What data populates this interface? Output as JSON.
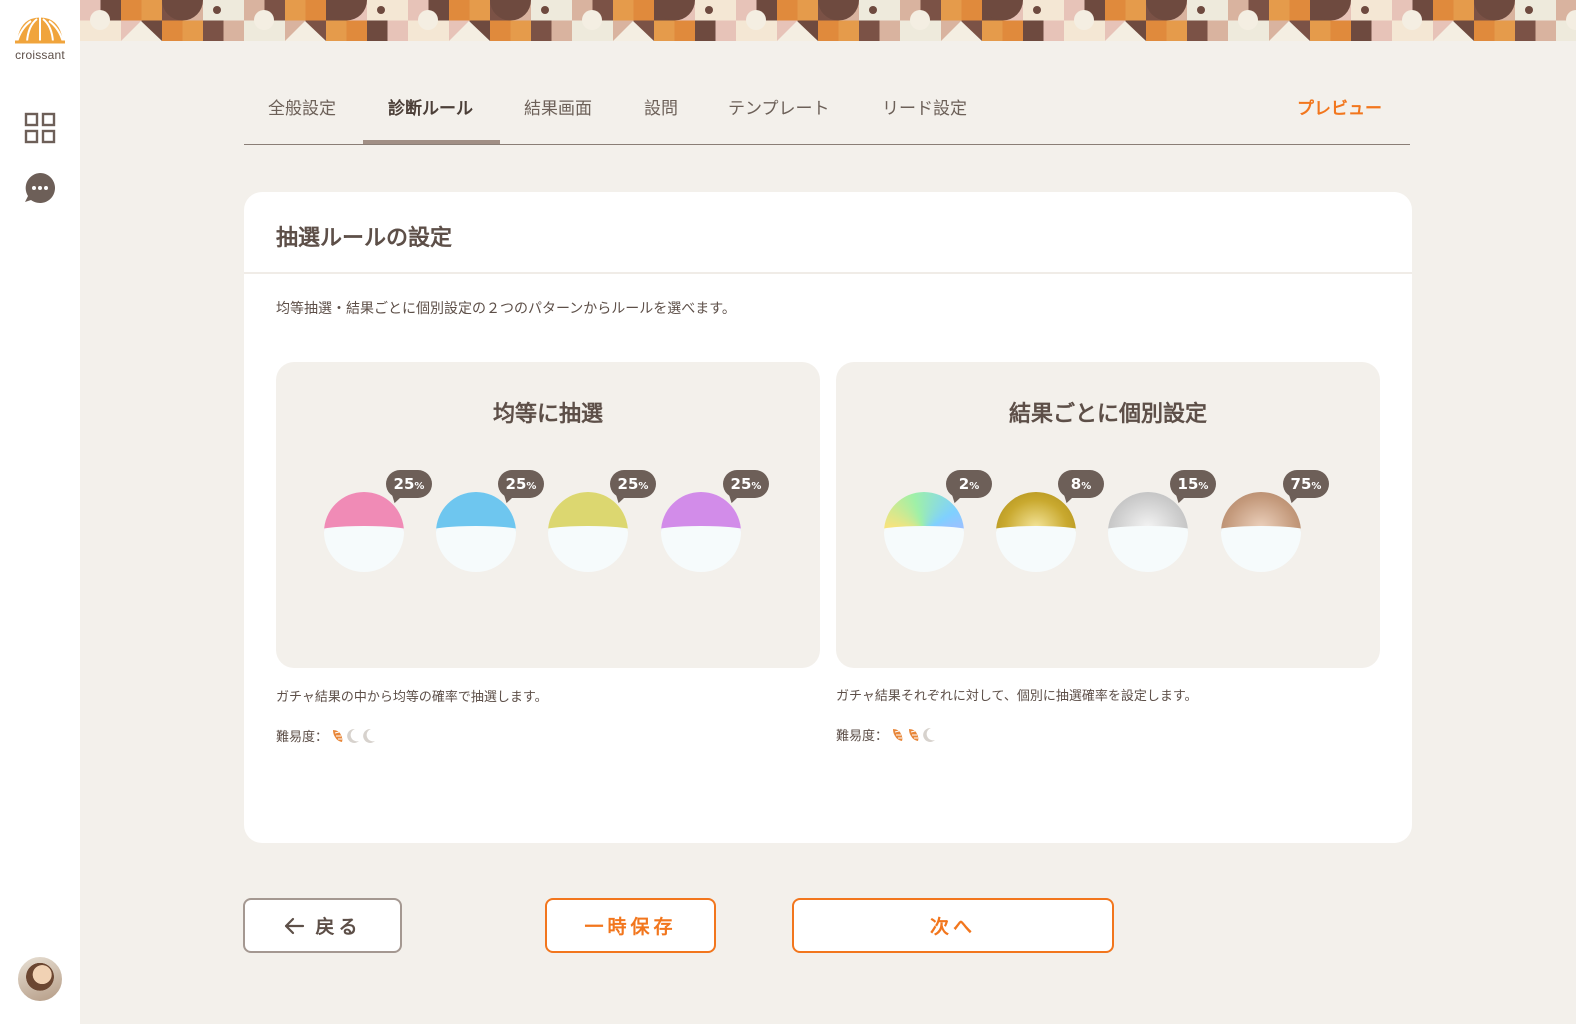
{
  "app": {
    "logo_text": "croissant",
    "brand_color": "#f2761d"
  },
  "sidebar": {
    "items": [
      {
        "icon": "grid-icon"
      },
      {
        "icon": "chat-bubble-icon"
      }
    ]
  },
  "tabs": {
    "items": [
      {
        "label": "全般設定"
      },
      {
        "label": "診断ルール"
      },
      {
        "label": "結果画面"
      },
      {
        "label": "設問"
      },
      {
        "label": "テンプレート"
      },
      {
        "label": "リード設定"
      }
    ],
    "active": "診断ルール",
    "preview_label": "プレビュー"
  },
  "card": {
    "title": "抽選ルールの設定",
    "description": "均等抽選・結果ごとに個別設定の２つのパターンからルールを選べます。",
    "options": [
      {
        "title": "均等に抽選",
        "balls": [
          {
            "percent": "25",
            "color": "#f08bb6"
          },
          {
            "percent": "25",
            "color": "#6ec6ef"
          },
          {
            "percent": "25",
            "color": "#dcd770"
          },
          {
            "percent": "25",
            "color": "#d28ce9"
          }
        ],
        "note": "ガチャ結果の中から均等の確率で抽選します。",
        "difficulty_label": "難易度：",
        "difficulty_level": 1,
        "difficulty_max": 3
      },
      {
        "title": "結果ごとに個別設定",
        "balls": [
          {
            "percent": "2",
            "color": "rainbow"
          },
          {
            "percent": "8",
            "color": "gold"
          },
          {
            "percent": "15",
            "color": "silver"
          },
          {
            "percent": "75",
            "color": "bronze"
          }
        ],
        "note": "ガチャ結果それぞれに対して、個別に抽選確率を設定します。",
        "difficulty_label": "難易度：",
        "difficulty_level": 2,
        "difficulty_max": 3
      }
    ],
    "percent_unit": "%"
  },
  "footer": {
    "back_label": "戻る",
    "save_label": "一時保存",
    "next_label": "次へ"
  }
}
